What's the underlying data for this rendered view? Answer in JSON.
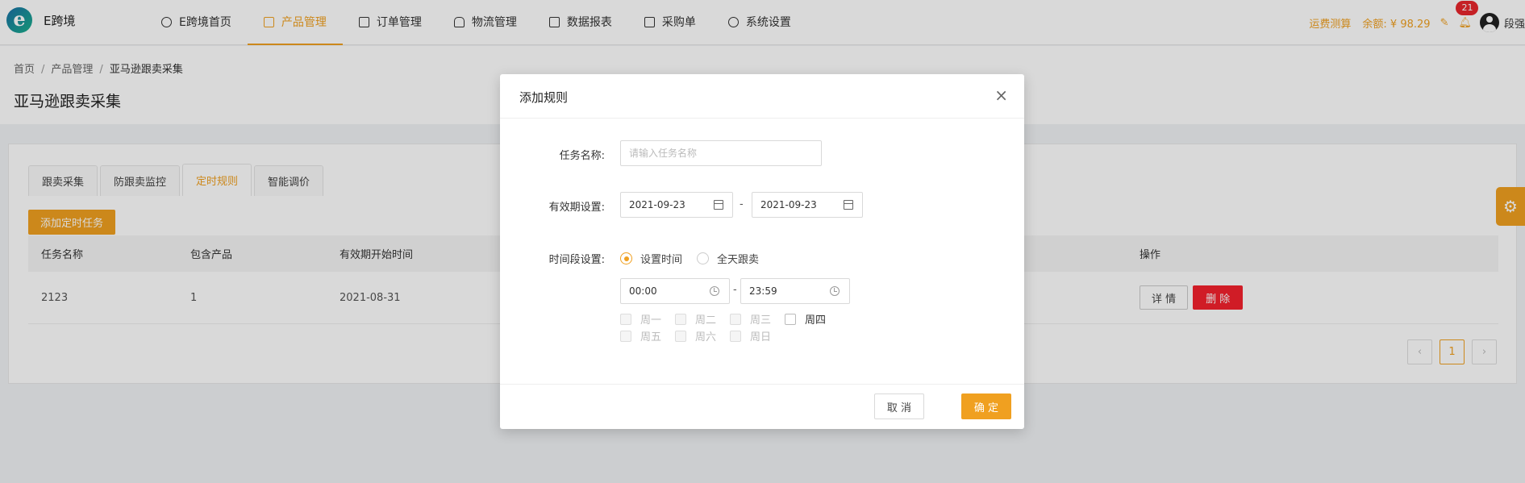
{
  "topbar": {
    "logo_letter": "e",
    "brand": "E跨境",
    "nav": [
      {
        "label": "E跨境首页",
        "icon": "e-icon"
      },
      {
        "label": "产品管理",
        "icon": "box-icon"
      },
      {
        "label": "订单管理",
        "icon": "list-icon"
      },
      {
        "label": "物流管理",
        "icon": "truck-icon"
      },
      {
        "label": "数据报表",
        "icon": "report-icon"
      },
      {
        "label": "采购单",
        "icon": "document-icon"
      },
      {
        "label": "系统设置",
        "icon": "gear-icon"
      }
    ],
    "shipping_calc": "运费测算",
    "balance": "余额: ¥ 98.29",
    "notification_count": "21",
    "username": "段强"
  },
  "breadcrumb": {
    "items": [
      "首页",
      "产品管理",
      "亚马逊跟卖采集"
    ],
    "separator": "/"
  },
  "page_title": "亚马逊跟卖采集",
  "tabs": [
    "跟卖采集",
    "防跟卖监控",
    "定时规则",
    "智能调价"
  ],
  "add_button": "添加定时任务",
  "table": {
    "headers": [
      "任务名称",
      "包含产品",
      "有效期开始时间",
      "操作"
    ],
    "rows": [
      {
        "name": "2123",
        "products": "1",
        "start": "2021-08-31"
      }
    ],
    "detail_button": "详 情",
    "delete_button": "删 除"
  },
  "pagination": {
    "prev": "‹",
    "current": "1",
    "next": "›"
  },
  "dialog": {
    "title": "添加规则",
    "close_symbol": "×",
    "task_name_label": "任务名称:",
    "task_name_placeholder": "请输入任务名称",
    "validity_label": "有效期设置:",
    "validity_start": "2021-09-23",
    "validity_end": "2021-09-23",
    "range_separator": "-",
    "time_label": "时间段设置:",
    "radio_set_time": "设置时间",
    "radio_all_day": "全天跟卖",
    "time_start": "00:00",
    "time_end": "23:59",
    "weekdays": [
      "周一",
      "周二",
      "周三",
      "周四",
      "周五",
      "周六",
      "周日"
    ],
    "cancel_button": "取 消",
    "ok_button": "确 定"
  },
  "colors": {
    "accent": "#f0a020",
    "danger": "#f5222d",
    "badge": "#e8262c"
  }
}
